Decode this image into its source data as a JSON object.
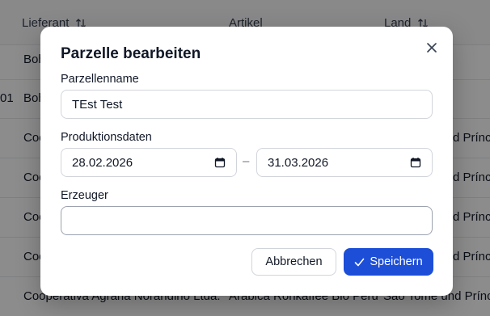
{
  "table": {
    "headers": [
      {
        "label": "Lieferant"
      },
      {
        "label": "Artikel"
      },
      {
        "label": "Land"
      }
    ],
    "rows": [
      {
        "id": "",
        "lieferant": "Boh",
        "artikel": "",
        "land": ""
      },
      {
        "id": "01",
        "lieferant": "Boh",
        "artikel": "",
        "land": ""
      },
      {
        "id": "",
        "lieferant": "Coo",
        "artikel": "",
        "land": "d Prínc"
      },
      {
        "id": "",
        "lieferant": "Coo",
        "artikel": "",
        "land": "d Prínc"
      },
      {
        "id": "",
        "lieferant": "Coo",
        "artikel": "",
        "land": "d Prínc"
      },
      {
        "id": "",
        "lieferant": "Coo",
        "artikel": "",
        "land": "d Prínc"
      },
      {
        "id": "",
        "lieferant": "Cooperativa Agraria Norandino Ltda.",
        "artikel": "Arabica Rohkaffee Bio Peru",
        "land": "São Tomé und Prínc"
      }
    ]
  },
  "dialog": {
    "title": "Parzelle bearbeiten",
    "name_label": "Parzellenname",
    "name_value": "TEst Test",
    "dates_label": "Produktionsdaten",
    "date_from": "28.02.2026",
    "date_to": "31.03.2026",
    "date_separator": "–",
    "producer_label": "Erzeuger",
    "producer_value": "",
    "cancel_label": "Abbrechen",
    "save_label": "Speichern"
  },
  "colors": {
    "primary": "#1d4ed8",
    "overlay": "rgba(0,0,0,0.45)"
  }
}
